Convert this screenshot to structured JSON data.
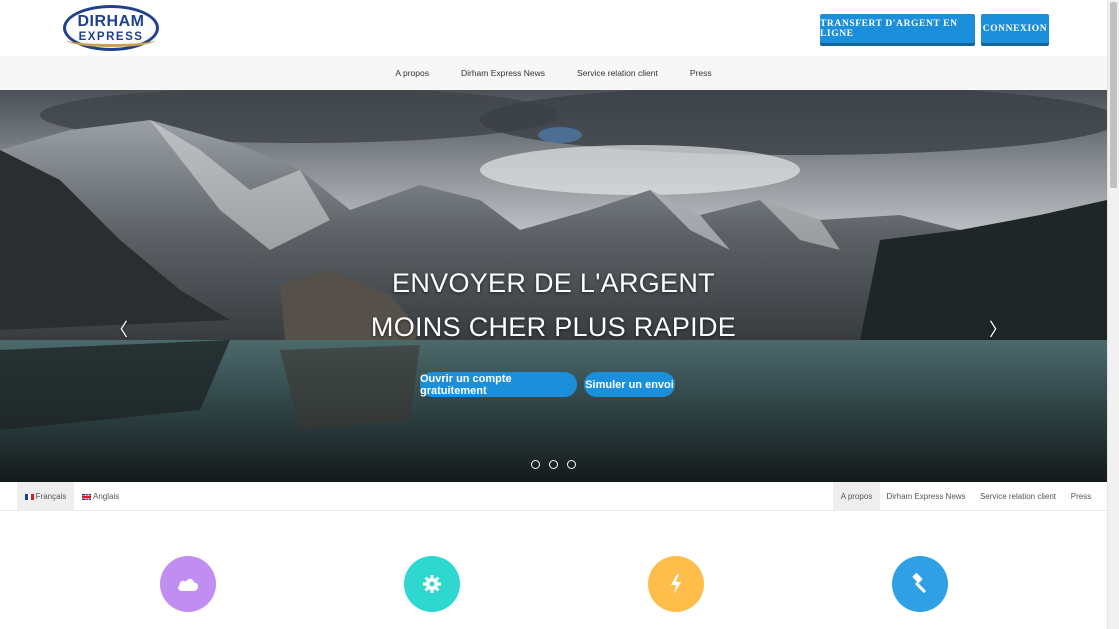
{
  "header": {
    "logo_line1": "DIRHAM",
    "logo_line2": "EXPRESS",
    "transfer_button": "TRANSFERT D'ARGENT EN LIGNE",
    "login_button": "CONNEXION"
  },
  "top_nav": {
    "items": [
      {
        "label": "A propos"
      },
      {
        "label": "Dirham Express News"
      },
      {
        "label": "Service relation client"
      },
      {
        "label": "Press"
      }
    ]
  },
  "hero": {
    "title_line1": "ENVOYER DE L'ARGENT",
    "title_line2": "MOINS CHER PLUS RAPIDE",
    "open_account_button": "Ouvrir un compte gratuitement",
    "simulate_button": "Simuler un envoi",
    "prev_arrow": "〈",
    "next_arrow": "〉",
    "slide_count": 3,
    "active_slide": 1
  },
  "language_bar": {
    "languages": [
      {
        "label": "Français",
        "active": true
      },
      {
        "label": "Anglais",
        "active": false
      }
    ],
    "nav": [
      {
        "label": "A propos",
        "active": true
      },
      {
        "label": "Dirham Express News"
      },
      {
        "label": "Service relation client"
      },
      {
        "label": "Press"
      }
    ]
  },
  "features": [
    {
      "icon": "cloud-icon",
      "color": "#c08df0"
    },
    {
      "icon": "gear-icon",
      "color": "#2ed8cf"
    },
    {
      "icon": "lightning-icon",
      "color": "#ffbd4a"
    },
    {
      "icon": "gavel-icon",
      "color": "#2f9fe6"
    }
  ],
  "colors": {
    "brand_blue": "#1c8fdb",
    "logo_navy": "#1f3f8f"
  }
}
